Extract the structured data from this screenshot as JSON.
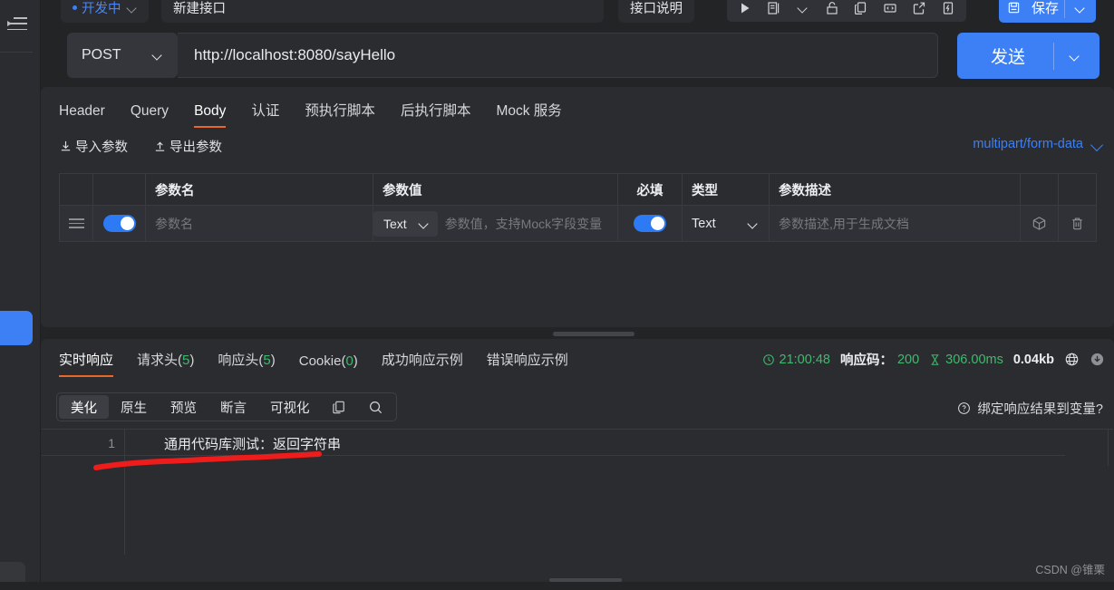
{
  "window": {
    "watermark": "CSDN @锥栗"
  },
  "rail": {
    "menu_icon": "hamburger-collapse-icon"
  },
  "doc_tabs": {
    "status_label": "开发中",
    "name_label": "新建接口",
    "desc_label": "接口说明"
  },
  "toolbar": {
    "icons": [
      "run-icon",
      "doc-icon",
      "chevron-down-icon",
      "unlock-icon",
      "copy-icon",
      "code-icon",
      "share-icon",
      "lightning-icon"
    ],
    "save_label": "保存"
  },
  "urlbar": {
    "method": "POST",
    "url": "http://localhost:8080/sayHello",
    "send_label": "发送"
  },
  "request": {
    "tabs": [
      {
        "label": "Header",
        "active": false
      },
      {
        "label": "Query",
        "active": false
      },
      {
        "label": "Body",
        "active": true
      },
      {
        "label": "认证",
        "active": false
      },
      {
        "label": "预执行脚本",
        "active": false
      },
      {
        "label": "后执行脚本",
        "active": false
      },
      {
        "label": "Mock 服务",
        "active": false
      }
    ],
    "import_label": "导入参数",
    "export_label": "导出参数",
    "content_type": "multipart/form-data",
    "table": {
      "headers": [
        "",
        "",
        "参数名",
        "参数值",
        "必填",
        "类型",
        "参数描述",
        "",
        ""
      ],
      "rows": [
        {
          "enabled": true,
          "name_placeholder": "参数名",
          "value_type": "Text",
          "value_placeholder": "参数值，支持Mock字段变量",
          "required": true,
          "type": "Text",
          "desc_placeholder": "参数描述,用于生成文档",
          "box_icon": "box-icon",
          "delete_icon": "trash-icon"
        }
      ]
    }
  },
  "response": {
    "tabs": [
      {
        "label": "实时响应",
        "count": null,
        "active": true
      },
      {
        "label": "请求头",
        "count": "5",
        "active": false
      },
      {
        "label": "响应头",
        "count": "5",
        "active": false
      },
      {
        "label": "Cookie",
        "count": "0",
        "active": false
      },
      {
        "label": "成功响应示例",
        "count": null,
        "active": false
      },
      {
        "label": "错误响应示例",
        "count": null,
        "active": false
      }
    ],
    "meta": {
      "time": "21:00:48",
      "code_label": "响应码：",
      "code_value": "200",
      "duration": "306.00ms",
      "size": "0.04kb",
      "globe_icon": "globe-icon",
      "download_icon": "download-icon"
    },
    "view_modes": [
      {
        "label": "美化",
        "active": true
      },
      {
        "label": "原生",
        "active": false
      },
      {
        "label": "预览",
        "active": false
      },
      {
        "label": "断言",
        "active": false
      },
      {
        "label": "可视化",
        "active": false
      }
    ],
    "copy_icon": "copy-icon",
    "search_icon": "search-icon",
    "bind_hint": "绑定响应结果到变量?",
    "editor": {
      "line_number": "1",
      "content": "通用代码库测试：返回字符串"
    }
  },
  "colors": {
    "accent_blue": "#3d7ff5",
    "accent_orange": "#e8682c",
    "green": "#3fba6d",
    "annotation_red": "#ef1c1c",
    "panel_bg": "#2b2c30",
    "app_bg": "#232426"
  }
}
